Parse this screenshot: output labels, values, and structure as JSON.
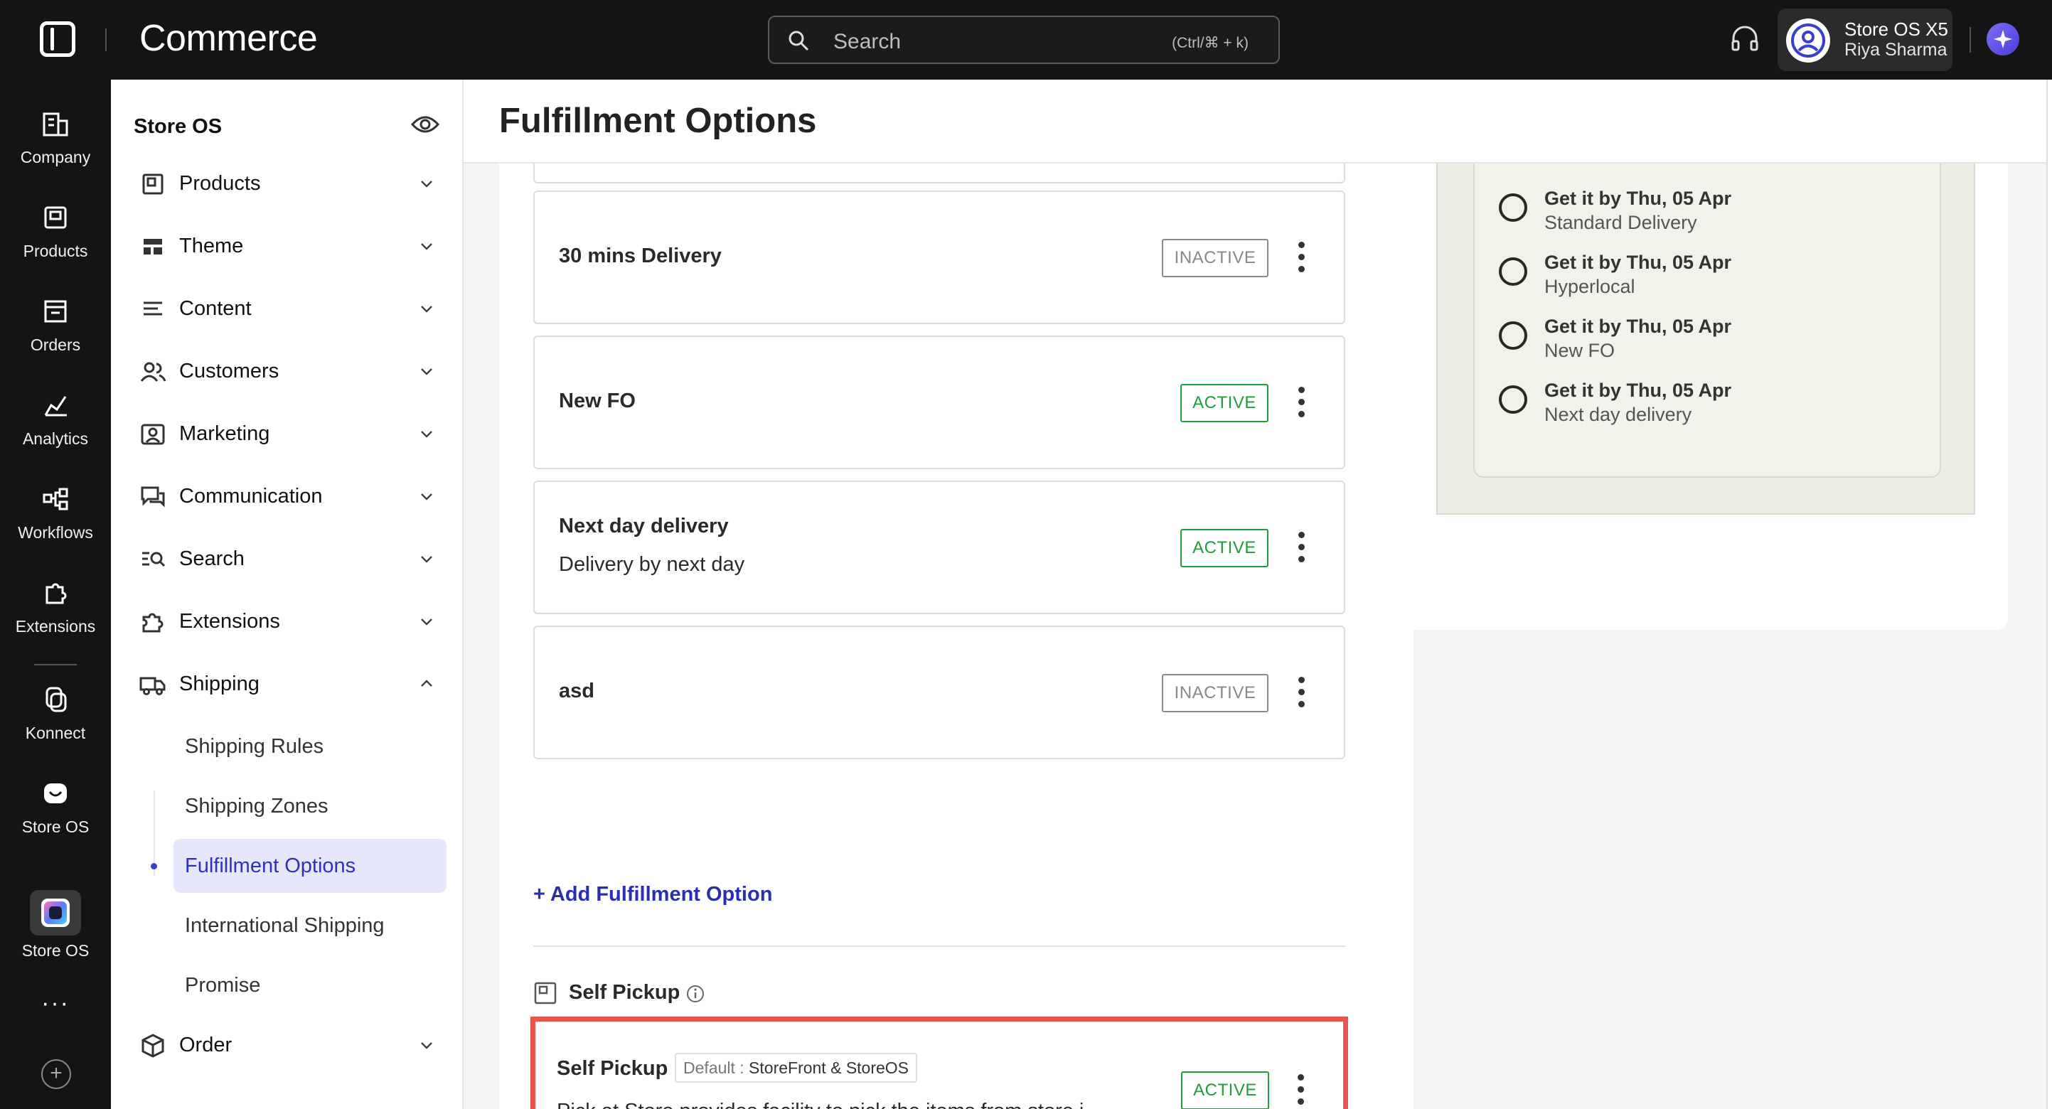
{
  "topbar": {
    "app_title": "Commerce",
    "search_placeholder": "Search",
    "search_shortcut": "(Ctrl/⌘ + k)",
    "user_store": "Store OS X5",
    "user_name": "Riya Sharma",
    "icons": [
      "app-logo-icon",
      "search-icon",
      "headset-icon",
      "user-avatar-icon",
      "ai-sparkle-icon"
    ]
  },
  "rail": {
    "items": [
      {
        "label": "Company",
        "icon": "building-icon"
      },
      {
        "label": "Products",
        "icon": "box-icon"
      },
      {
        "label": "Orders",
        "icon": "orders-icon"
      },
      {
        "label": "Analytics",
        "icon": "chart-icon"
      },
      {
        "label": "Workflows",
        "icon": "workflow-icon"
      },
      {
        "label": "Extensions",
        "icon": "puzzle-icon"
      },
      {
        "label": "Konnect",
        "icon": "konnect-icon"
      },
      {
        "label": "Store OS",
        "icon": "storeos-icon"
      },
      {
        "label": "Store OS",
        "icon": "storeos-app-icon"
      }
    ],
    "more": "···",
    "add": "+"
  },
  "sidebar": {
    "title": "Store OS",
    "items": [
      {
        "label": "Products"
      },
      {
        "label": "Theme"
      },
      {
        "label": "Content"
      },
      {
        "label": "Customers"
      },
      {
        "label": "Marketing"
      },
      {
        "label": "Communication"
      },
      {
        "label": "Search"
      },
      {
        "label": "Extensions"
      },
      {
        "label": "Shipping"
      },
      {
        "label": "Order"
      }
    ],
    "shipping_sub": [
      {
        "label": "Shipping Rules"
      },
      {
        "label": "Shipping Zones"
      },
      {
        "label": "Fulfillment Options"
      },
      {
        "label": "International Shipping"
      },
      {
        "label": "Promise"
      }
    ]
  },
  "main": {
    "title": "Fulfillment Options",
    "options": [
      {
        "name": "30 mins Delivery",
        "desc": "",
        "status": "INACTIVE"
      },
      {
        "name": "New FO",
        "desc": "",
        "status": "ACTIVE"
      },
      {
        "name": "Next day delivery",
        "desc": "Delivery by next day",
        "status": "ACTIVE"
      },
      {
        "name": "asd",
        "desc": "",
        "status": "INACTIVE"
      }
    ],
    "add_label": "+ Add Fulfillment Option",
    "self_pickup": {
      "section_label": "Self Pickup",
      "name": "Self Pickup",
      "tag_prefix": "Default : ",
      "tag_value": "StoreFront & StoreOS",
      "desc": "Pick at Store provides facility to pick the items from store i...",
      "status": "ACTIVE"
    }
  },
  "preview": {
    "items": [
      {
        "title": "Get it by Thu, 05 Apr",
        "sub": "Standard Delivery"
      },
      {
        "title": "Get it by Thu, 05 Apr",
        "sub": "Hyperlocal"
      },
      {
        "title": "Get it by Thu, 05 Apr",
        "sub": "New FO"
      },
      {
        "title": "Get it by Thu, 05 Apr",
        "sub": "Next day delivery"
      }
    ]
  },
  "colors": {
    "active": "#1f9d3a",
    "inactive": "#888888",
    "accent": "#2e31be",
    "highlight_border": "#e8554a"
  }
}
